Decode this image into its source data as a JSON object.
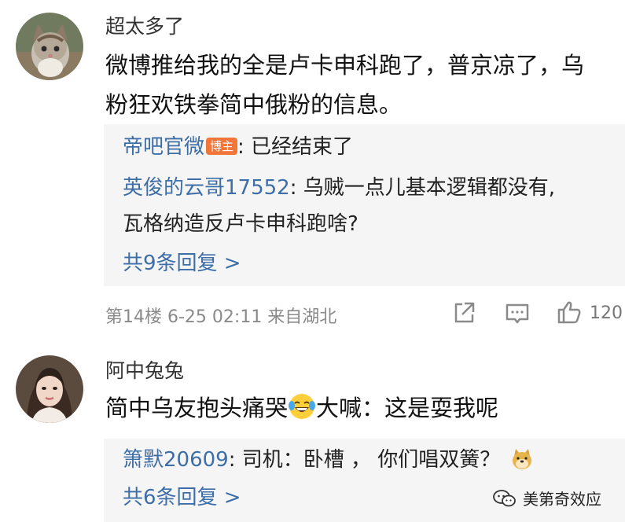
{
  "comments": [
    {
      "username": "超太多了",
      "avatar_icon": "kitten-avatar",
      "text_line_1": "微博推给我的全是卢卡申科跑了，普京凉了，乌",
      "text_line_2": "粉狂欢铁拳简中俄粉的信息。",
      "replies": [
        {
          "name": "帝吧官微",
          "badge": "博主",
          "text": ": 已经结束了"
        },
        {
          "name": "英俊的云哥17552",
          "text": ": 乌贼一点儿基本逻辑都没有,"
        },
        {
          "name": "",
          "text": "瓦格纳造反卢卡申科跑啥?"
        }
      ],
      "more_replies": "共9条回复 >",
      "meta": "第14楼 6-25 02:11 来自湖北",
      "like_count": "120"
    },
    {
      "username": "阿中兔兔",
      "avatar_icon": "woman-avatar",
      "text_before_emoji": "简中乌友抱头痛哭",
      "emoji_icon": "laughing-crying-emoji",
      "text_after_emoji": "大喊：这是耍我呢",
      "replies": [
        {
          "name": "箫默20609",
          "text": ": 司机：卧槽 ， 你们唱双簧？",
          "emoji_icon": "doge-emoji"
        }
      ],
      "more_replies": "共6条回复 >"
    }
  ],
  "watermark": {
    "text": "美第奇效应",
    "icon": "wechat-icon"
  },
  "colors": {
    "link": "#3e6ea8",
    "badge": "#f2753a",
    "reply_bg": "#f5f5f5"
  }
}
